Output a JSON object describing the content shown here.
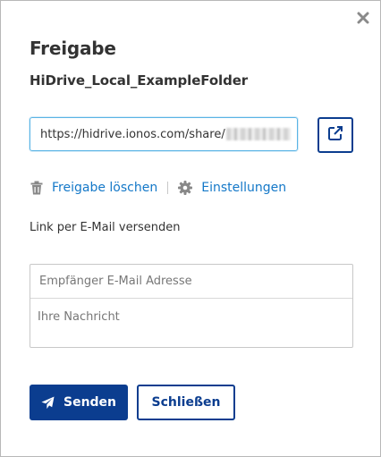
{
  "dialog": {
    "title": "Freigabe",
    "folder_name": "HiDrive_Local_ExampleFolder",
    "close_icon": "close-x-icon"
  },
  "share_link": {
    "url_visible": "https://hidrive.ionos.com/share/",
    "open_icon": "external-link-icon"
  },
  "actions": {
    "delete_label": "Freigabe löschen",
    "delete_icon": "trash-icon",
    "settings_label": "Einstellungen",
    "settings_icon": "gear-icon"
  },
  "email": {
    "section_label": "Link per E-Mail versenden",
    "recipient_placeholder": "Empfänger E-Mail Adresse",
    "message_placeholder": "Ihre Nachricht"
  },
  "buttons": {
    "send_label": "Senden",
    "send_icon": "paper-plane-icon",
    "close_label": "Schließen"
  },
  "colors": {
    "primary": "#0b3d8f",
    "link": "#1478c8",
    "focus_border": "#5ab4e5"
  }
}
